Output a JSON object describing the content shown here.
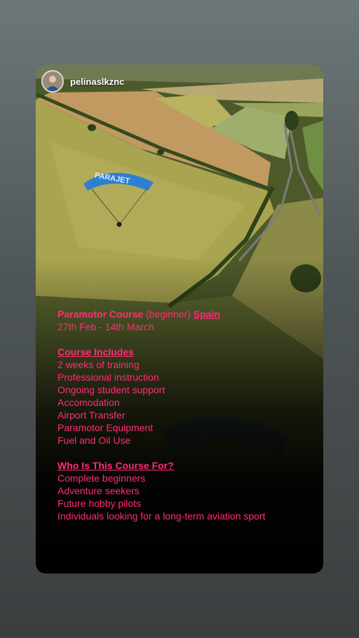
{
  "story": {
    "username": "pelinaslkznc",
    "paraglider_brand": "PARAJET",
    "title_bold": "Paramotor Course",
    "title_light": "(beginner)",
    "title_location": "Spain",
    "dates": "27th Feb - 14th March",
    "includes_heading": "Course Includes",
    "includes": [
      "2 weeks of training",
      "Professional instruction",
      "Ongoing student support",
      "Accomodation",
      "Airport Transfer",
      "Paramotor Equipment",
      "Fuel and Oil Use"
    ],
    "audience_heading": "Who Is This Course For?",
    "audience": [
      "Complete beginners",
      "Adventure seekers",
      "Future hobby pilots",
      "Individuals looking for a long-term aviation sport"
    ]
  },
  "colors": {
    "text_accent": "#ff2d78",
    "backdrop": "#5a6263",
    "wing": "#2f7fd0"
  }
}
